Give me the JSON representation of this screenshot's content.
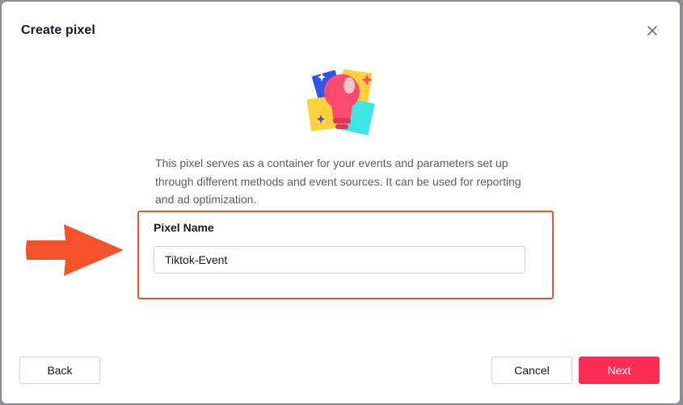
{
  "modal": {
    "title": "Create pixel",
    "description": "This pixel serves as a container for your events and parameters set up through different methods and event sources. It can be used for reporting and ad optimization.",
    "field_label": "Pixel Name",
    "pixel_name_value": "Tiktok-Event",
    "back_label": "Back",
    "cancel_label": "Cancel",
    "next_label": "Next"
  },
  "icons": {
    "close": "close-icon",
    "illustration": "lightbulb-illustration",
    "annotation_arrow": "arrow-right-icon"
  },
  "colors": {
    "primary": "#fe2c55",
    "annotation": "#f4522b",
    "title_text": "#161823",
    "body_text": "#5b5d63"
  }
}
